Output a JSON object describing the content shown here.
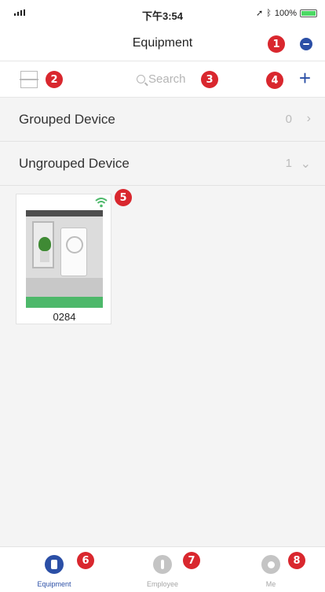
{
  "status_bar": {
    "time": "下午3:54",
    "battery": "100%",
    "battery_level": 1.0
  },
  "nav": {
    "title": "Equipment"
  },
  "toolbar": {
    "search_placeholder": "Search",
    "add_label": "+"
  },
  "groups": [
    {
      "label": "Grouped Device",
      "count": "0",
      "chevron": "›"
    },
    {
      "label": "Ungrouped Device",
      "count": "1",
      "chevron": "⌄"
    }
  ],
  "device": {
    "name": "0284",
    "status_color": "#4db86a",
    "wifi_color": "#4db86a"
  },
  "tabs": [
    {
      "label": "Equipment",
      "icon": "equipment-icon",
      "active": true
    },
    {
      "label": "Employee",
      "icon": "employee-icon",
      "active": false
    },
    {
      "label": "Me",
      "icon": "me-icon",
      "active": false
    }
  ],
  "badges": [
    "1",
    "2",
    "3",
    "4",
    "5",
    "6",
    "7",
    "8"
  ],
  "colors": {
    "accent": "#2b4fa6",
    "badge": "#d9272e",
    "inactive": "#c4c4c4"
  }
}
